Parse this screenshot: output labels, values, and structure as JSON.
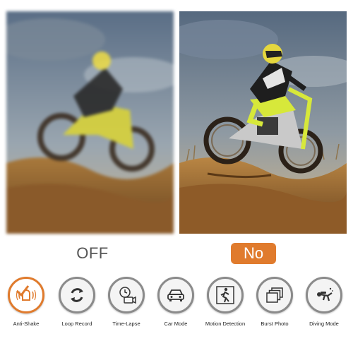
{
  "comparison": {
    "left_label": "OFF",
    "right_label": "No"
  },
  "features": [
    {
      "label": "Anti-Shake",
      "icon": "anti-shake-icon",
      "active": true
    },
    {
      "label": "Loop Record",
      "icon": "loop-record-icon",
      "active": false
    },
    {
      "label": "Time-Lapse",
      "icon": "time-lapse-icon",
      "active": false
    },
    {
      "label": "Car Mode",
      "icon": "car-mode-icon",
      "active": false
    },
    {
      "label": "Motion Detection",
      "icon": "motion-detection-icon",
      "active": false
    },
    {
      "label": "Burst Photo",
      "icon": "burst-photo-icon",
      "active": false
    },
    {
      "label": "Diving Mode",
      "icon": "diving-mode-icon",
      "active": false
    }
  ],
  "colors": {
    "accent": "#e07b2d",
    "icon_ring": "#8b8b8b"
  }
}
